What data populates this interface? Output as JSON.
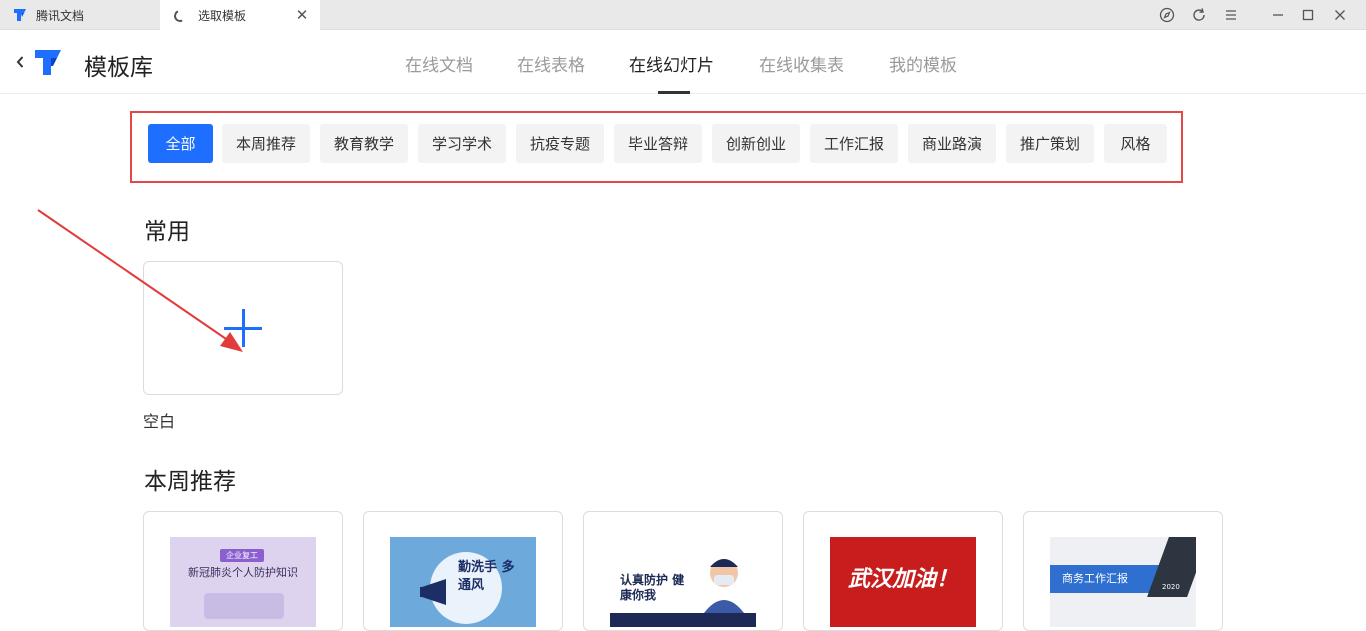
{
  "tabs": [
    {
      "label": "腾讯文档"
    },
    {
      "label": "选取模板"
    }
  ],
  "header": {
    "title": "模板库",
    "nav": [
      {
        "label": "在线文档"
      },
      {
        "label": "在线表格"
      },
      {
        "label": "在线幻灯片"
      },
      {
        "label": "在线收集表"
      },
      {
        "label": "我的模板"
      }
    ],
    "active_nav": "在线幻灯片"
  },
  "categories": [
    "全部",
    "本周推荐",
    "教育教学",
    "学习学术",
    "抗疫专题",
    "毕业答辩",
    "创新创业",
    "工作汇报",
    "商业路演",
    "推广策划",
    "风格"
  ],
  "active_category": "全部",
  "common": {
    "title": "常用",
    "blank_label": "空白"
  },
  "weekly": {
    "title": "本周推荐",
    "templates": [
      {
        "badge": "企业复工",
        "text": "新冠肺炎个人防护知识"
      },
      {
        "text": "勤洗手 多通风"
      },
      {
        "text": "认真防护 健康你我"
      },
      {
        "text": "武汉加油！"
      },
      {
        "text": "商务工作汇报",
        "year": "2020"
      }
    ]
  },
  "colors": {
    "accent": "#1e6fff",
    "highlight_box": "#e34848",
    "arrow": "#e23b3b"
  }
}
